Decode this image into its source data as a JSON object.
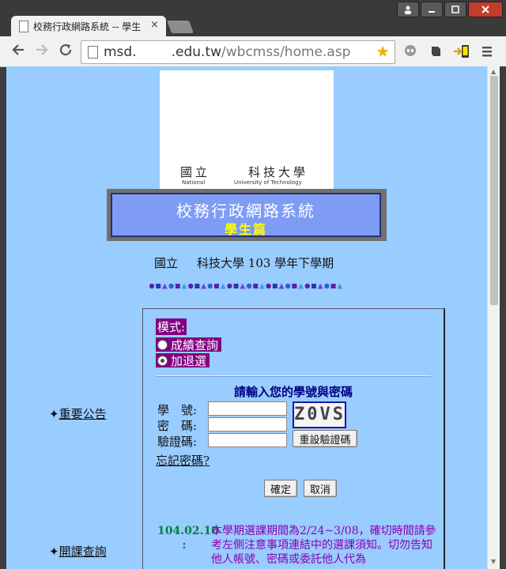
{
  "browser": {
    "tab_title": "校務行政網路系統 -- 學生",
    "tab_close": "×",
    "url_prefix": "msd.",
    "url_domain": ".edu.tw",
    "url_path": "/wbcmss/home.asp"
  },
  "logo": {
    "cn_left": "國立",
    "cn_right": "科技大學",
    "en_left": "National",
    "en_right": "University of Technology"
  },
  "banner": {
    "title": "校務行政網路系統",
    "subtitle": "學生篇"
  },
  "semester": {
    "prefix": "國立",
    "suffix": "科技大學 103 學年下學期"
  },
  "sidebar": {
    "announcement": "重要公告",
    "course_query": "開課查詢",
    "bullet": "✦"
  },
  "login": {
    "mode_label": "模式:",
    "modes": [
      {
        "label": "成績查詢",
        "selected": false
      },
      {
        "label": "加退選",
        "selected": true
      }
    ],
    "prompt": "請輸入您的學號與密碼",
    "student_id_label": "學　號:",
    "password_label": "密　碼:",
    "captcha_label": "驗證碼:",
    "student_id_value": "",
    "password_value": "",
    "captcha_value": "",
    "captcha_text": "Z0VS",
    "reset_captcha": "重設驗證碼",
    "forgot": "忘記密碼?",
    "ok": "確定",
    "cancel": "取消"
  },
  "news": {
    "date": "104.02.10 :",
    "text": "本學期選課期間為2/24~3/08，確切時間請參考左側注意事項連結中的選課須知。切勿告知他人帳號、密碼或委託他人代為"
  },
  "colors": {
    "page_bg": "#99ccff",
    "purple": "#800080",
    "banner_blue": "#7f9cf5",
    "date_green": "#008040",
    "news_purple": "#8b00b0"
  }
}
